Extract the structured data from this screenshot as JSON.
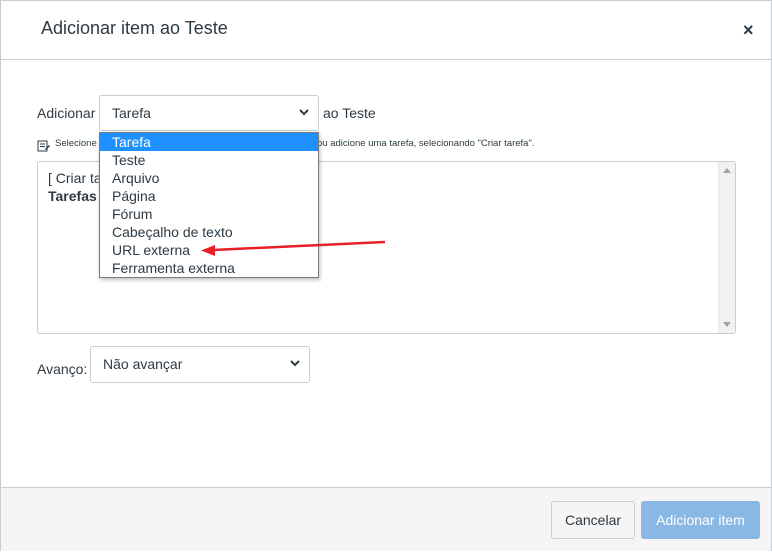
{
  "dialog": {
    "title": "Adicionar item ao Teste",
    "close": "×"
  },
  "add_row": {
    "label": "Adicionar",
    "selected_type": "Tarefa",
    "suffix": "ao Teste"
  },
  "hint": {
    "left_text": "Selecione",
    "right_text": "ou adicione uma tarefa, selecionando \"Criar tarefa\"."
  },
  "item_list": {
    "first_option": "[ Criar ta",
    "group_label": "Tarefas"
  },
  "type_dropdown": {
    "options": [
      "Tarefa",
      "Teste",
      "Arquivo",
      "Página",
      "Fórum",
      "Cabeçalho de texto",
      "URL externa",
      "Ferramenta externa"
    ],
    "highlighted": "Tarefa"
  },
  "advance": {
    "label": "Avanço:",
    "selected": "Não avançar"
  },
  "footer": {
    "cancel_label": "Cancelar",
    "submit_label": "Adicionar item"
  },
  "colors": {
    "highlight": "#1e90ff",
    "primary_button": "#8ab8e5",
    "annotation_arrow": "#e8202a"
  }
}
